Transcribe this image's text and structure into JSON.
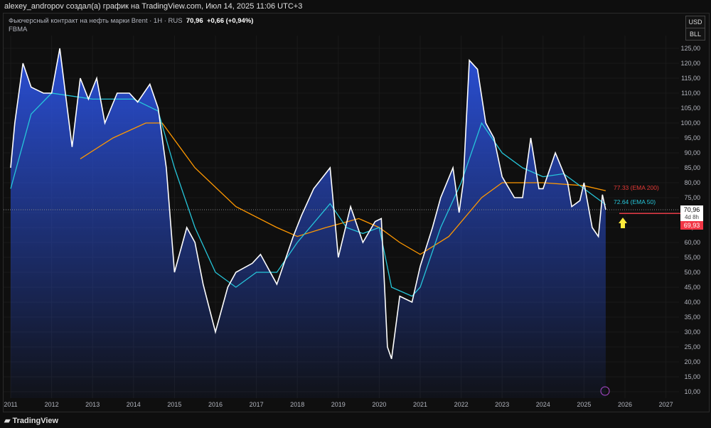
{
  "header": {
    "author_line": "alexey_andropov создал(а) график на TradingView.com, Июл 14, 2025 11:06 UTC+3"
  },
  "legend": {
    "symbol": "Фьючерсный контракт на нефть марки Brent · 1H · RUS",
    "price": "70,96",
    "change": "+0,66 (+0,94%)",
    "ticker": "FBMA"
  },
  "units": {
    "currency": "USD",
    "unit": "BLL"
  },
  "footer": {
    "brand": "TradingView"
  },
  "chart_data": {
    "type": "area",
    "ylim": [
      10,
      125
    ],
    "xlim": [
      2010.95,
      2027.3
    ],
    "yticks": [
      "10,00",
      "15,00",
      "20,00",
      "25,00",
      "30,00",
      "35,00",
      "40,00",
      "45,00",
      "50,00",
      "55,00",
      "60,00",
      "65,00",
      "70,00",
      "75,00",
      "80,00",
      "85,00",
      "90,00",
      "95,00",
      "100,00",
      "105,00",
      "110,00",
      "115,00",
      "120,00",
      "125,00"
    ],
    "xticks": [
      "2011",
      "2012",
      "2013",
      "2014",
      "2015",
      "2016",
      "2017",
      "2018",
      "2019",
      "2020",
      "2021",
      "2022",
      "2023",
      "2024",
      "2025",
      "2026",
      "2027"
    ],
    "price": {
      "name": "Brent",
      "color": "#ffffff",
      "points": [
        [
          2011.0,
          85
        ],
        [
          2011.1,
          100
        ],
        [
          2011.3,
          120
        ],
        [
          2011.5,
          112
        ],
        [
          2011.8,
          110
        ],
        [
          2012.0,
          110
        ],
        [
          2012.2,
          125
        ],
        [
          2012.5,
          92
        ],
        [
          2012.7,
          115
        ],
        [
          2012.9,
          108
        ],
        [
          2013.1,
          115
        ],
        [
          2013.3,
          100
        ],
        [
          2013.6,
          110
        ],
        [
          2013.9,
          110
        ],
        [
          2014.1,
          107
        ],
        [
          2014.4,
          113
        ],
        [
          2014.6,
          105
        ],
        [
          2014.8,
          85
        ],
        [
          2015.0,
          50
        ],
        [
          2015.3,
          65
        ],
        [
          2015.5,
          60
        ],
        [
          2015.7,
          46
        ],
        [
          2016.0,
          30
        ],
        [
          2016.3,
          45
        ],
        [
          2016.5,
          50
        ],
        [
          2016.9,
          53
        ],
        [
          2017.1,
          56
        ],
        [
          2017.5,
          46
        ],
        [
          2017.9,
          62
        ],
        [
          2018.1,
          69
        ],
        [
          2018.4,
          78
        ],
        [
          2018.8,
          85
        ],
        [
          2019.0,
          55
        ],
        [
          2019.3,
          72
        ],
        [
          2019.6,
          60
        ],
        [
          2019.9,
          67
        ],
        [
          2020.05,
          68
        ],
        [
          2020.2,
          25
        ],
        [
          2020.3,
          21
        ],
        [
          2020.5,
          42
        ],
        [
          2020.8,
          40
        ],
        [
          2021.0,
          52
        ],
        [
          2021.3,
          65
        ],
        [
          2021.5,
          75
        ],
        [
          2021.8,
          85
        ],
        [
          2021.95,
          70
        ],
        [
          2022.05,
          80
        ],
        [
          2022.2,
          121
        ],
        [
          2022.4,
          118
        ],
        [
          2022.6,
          100
        ],
        [
          2022.8,
          95
        ],
        [
          2023.0,
          82
        ],
        [
          2023.3,
          75
        ],
        [
          2023.5,
          75
        ],
        [
          2023.7,
          95
        ],
        [
          2023.9,
          78
        ],
        [
          2024.0,
          78
        ],
        [
          2024.3,
          90
        ],
        [
          2024.6,
          80
        ],
        [
          2024.7,
          72
        ],
        [
          2024.9,
          74
        ],
        [
          2025.0,
          80
        ],
        [
          2025.2,
          65
        ],
        [
          2025.35,
          62
        ],
        [
          2025.45,
          76
        ],
        [
          2025.53,
          70.96
        ]
      ]
    },
    "ema50": {
      "name": "EMA 50",
      "color": "#26c6da",
      "label": "72.64 (EMA 50)",
      "points": [
        [
          2011.0,
          78
        ],
        [
          2011.5,
          103
        ],
        [
          2012.0,
          110
        ],
        [
          2013.0,
          108
        ],
        [
          2014.0,
          108
        ],
        [
          2014.6,
          104
        ],
        [
          2015.0,
          85
        ],
        [
          2015.5,
          65
        ],
        [
          2016.0,
          50
        ],
        [
          2016.5,
          45
        ],
        [
          2017.0,
          50
        ],
        [
          2017.5,
          50
        ],
        [
          2018.0,
          60
        ],
        [
          2018.8,
          73
        ],
        [
          2019.2,
          65
        ],
        [
          2019.6,
          63
        ],
        [
          2020.0,
          65
        ],
        [
          2020.3,
          45
        ],
        [
          2020.8,
          42
        ],
        [
          2021.0,
          45
        ],
        [
          2021.5,
          65
        ],
        [
          2022.0,
          80
        ],
        [
          2022.5,
          100
        ],
        [
          2023.0,
          90
        ],
        [
          2023.5,
          85
        ],
        [
          2024.0,
          82
        ],
        [
          2024.5,
          83
        ],
        [
          2025.0,
          78
        ],
        [
          2025.53,
          72.64
        ]
      ]
    },
    "ema200": {
      "name": "EMA 200",
      "color": "#ff9800",
      "label": "77.33 (EMA 200)",
      "points": [
        [
          2012.7,
          88
        ],
        [
          2013.5,
          95
        ],
        [
          2014.3,
          100
        ],
        [
          2014.7,
          100
        ],
        [
          2015.5,
          85
        ],
        [
          2016.5,
          72
        ],
        [
          2017.5,
          65
        ],
        [
          2018.0,
          62
        ],
        [
          2018.7,
          65
        ],
        [
          2019.5,
          68
        ],
        [
          2020.0,
          65
        ],
        [
          2020.5,
          60
        ],
        [
          2021.0,
          56
        ],
        [
          2021.7,
          62
        ],
        [
          2022.5,
          75
        ],
        [
          2023.0,
          80
        ],
        [
          2024.0,
          80
        ],
        [
          2025.0,
          79
        ],
        [
          2025.53,
          77.33
        ]
      ]
    },
    "price_label": {
      "value": "70,96",
      "countdown": "4d 8h",
      "prev": "69,93"
    }
  }
}
